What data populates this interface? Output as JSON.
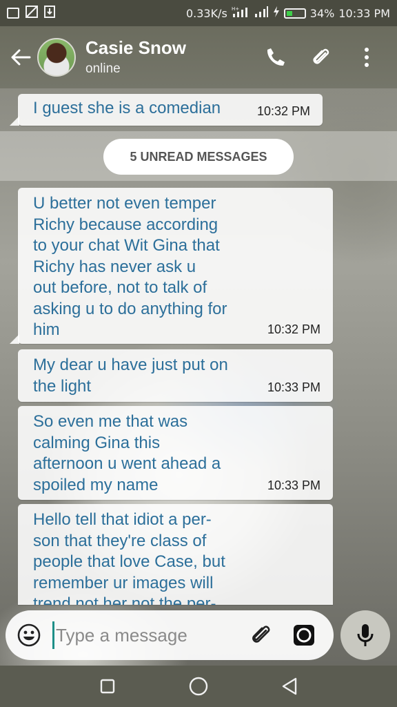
{
  "status_bar": {
    "network_speed": "0.33K/s",
    "battery_percent": "34%",
    "time": "10:33 PM",
    "icons": [
      "screenshot-icon",
      "no-sim-icon",
      "download-icon",
      "hplus-signal-icon",
      "signal-icon",
      "charging-icon",
      "battery-icon"
    ]
  },
  "header": {
    "contact_name": "Casie Snow",
    "contact_status": "online",
    "icons": [
      "back-arrow-icon",
      "phone-icon",
      "paperclip-icon",
      "more-vertical-icon"
    ]
  },
  "messages": [
    {
      "text": "I guest she is a comedian",
      "time": "10:32 PM"
    },
    {
      "text": "U better not even temper\nRichy because according\nto your chat Wit Gina that\nRichy has never ask u\nout before, not to talk of\nasking u to do anything for\nhim",
      "time": "10:32 PM"
    },
    {
      "text": "My dear u have just put on\nthe light",
      "time": "10:33 PM"
    },
    {
      "text": "So even me that was\ncalming Gina this\nafternoon u went ahead a\nspoiled my name",
      "time": "10:33 PM"
    },
    {
      "text": "Hello tell that idiot a per-\nson that they're class of\npeople that love Case, but\nremember ur images will\ntrend not her not the per-",
      "time": ""
    }
  ],
  "unread_banner": "5 UNREAD MESSAGES",
  "composer": {
    "placeholder": "Type a message",
    "icons": [
      "emoji-icon",
      "paperclip-icon",
      "camera-icon",
      "microphone-icon"
    ]
  },
  "nav": {
    "icons": [
      "recents-square-icon",
      "home-circle-icon",
      "back-triangle-icon"
    ]
  },
  "colors": {
    "header_bg": "#6b6c5e",
    "message_text": "#2c6f9a",
    "caret": "#1d8f88"
  }
}
